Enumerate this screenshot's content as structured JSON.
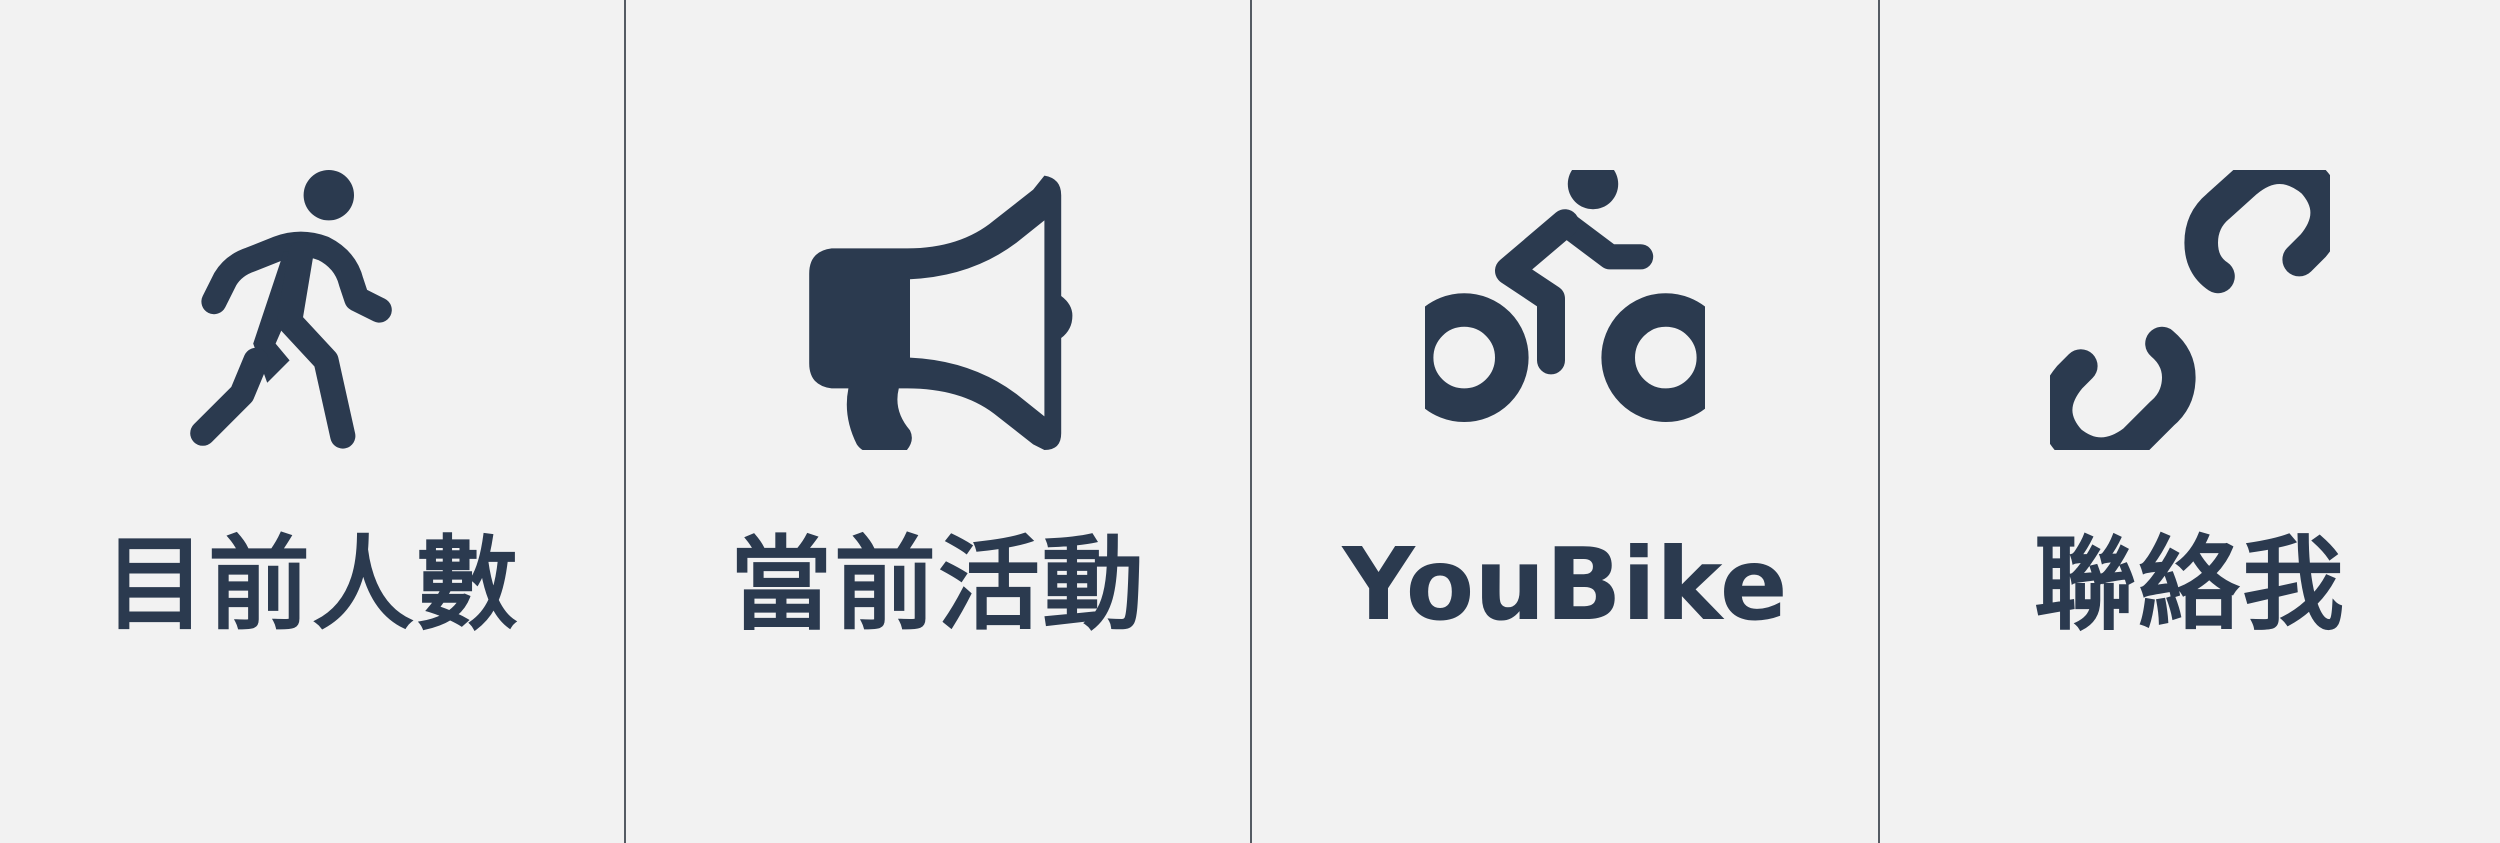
{
  "theme": {
    "background": "#f2f2f2",
    "icon_color": "#2b3a4f",
    "divider_color": "#555b63"
  },
  "tiles": [
    {
      "label": "目前人數",
      "icon": "person-walking-icon"
    },
    {
      "label": "當前活動",
      "icon": "megaphone-icon"
    },
    {
      "label": "YouBike",
      "icon": "person-biking-icon"
    },
    {
      "label": "聯絡我",
      "icon": "link-icon"
    }
  ]
}
